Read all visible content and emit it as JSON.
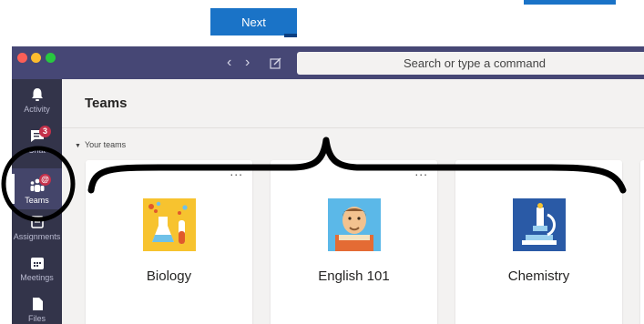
{
  "tutorial": {
    "next_label": "Next"
  },
  "toolbar": {
    "search_placeholder": "Search or type a command"
  },
  "rail": {
    "items": [
      {
        "label": "Activity",
        "icon": "bell-icon"
      },
      {
        "label": "Chat",
        "icon": "chat-icon",
        "badge": "3"
      },
      {
        "label": "Teams",
        "icon": "teams-icon",
        "badge": "@"
      },
      {
        "label": "Assignments",
        "icon": "assignments-icon"
      },
      {
        "label": "Meetings",
        "icon": "calendar-icon"
      },
      {
        "label": "Files",
        "icon": "file-icon"
      }
    ]
  },
  "page": {
    "title": "Teams"
  },
  "section": {
    "label": "Your teams"
  },
  "teams": [
    {
      "name": "Biology",
      "more": "...",
      "icon": "biology-icon"
    },
    {
      "name": "English 101",
      "more": "...",
      "icon": "english-icon"
    },
    {
      "name": "Chemistry",
      "more": "...",
      "icon": "chemistry-icon"
    }
  ],
  "colors": {
    "titlebar": "#464775",
    "rail": "#33344a",
    "accent_blue": "#1a73c7",
    "badge_red": "#c4314b"
  }
}
